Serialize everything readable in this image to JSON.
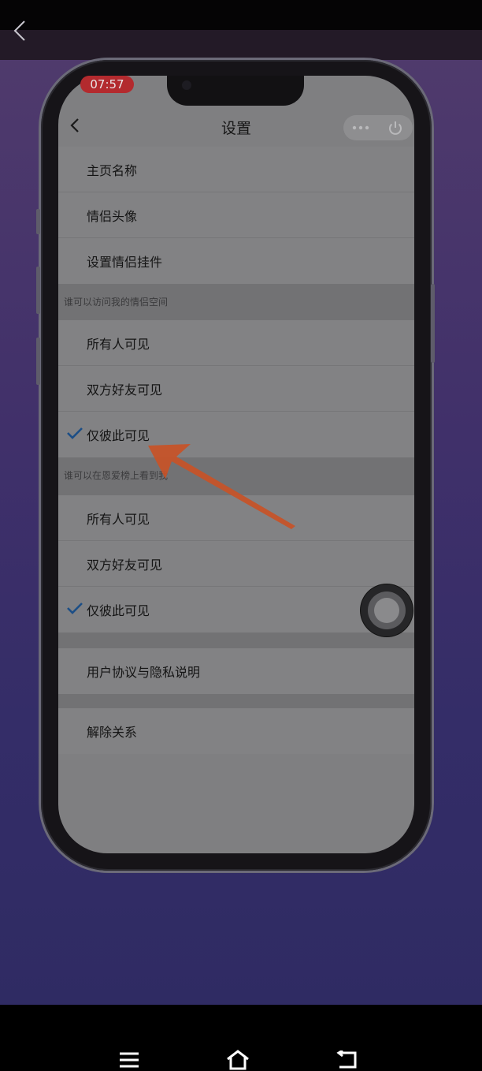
{
  "status": {
    "time": "07:57"
  },
  "header": {
    "title": "设置",
    "more_icon": "more-dots-icon",
    "close_icon": "power-icon"
  },
  "basic": {
    "items": [
      {
        "label": "主页名称"
      },
      {
        "label": "情侣头像"
      },
      {
        "label": "设置情侣挂件"
      }
    ]
  },
  "visit_section": {
    "title": "谁可以访问我的情侣空间",
    "options": [
      {
        "label": "所有人可见",
        "selected": false
      },
      {
        "label": "双方好友可见",
        "selected": false
      },
      {
        "label": "仅彼此可见",
        "selected": true
      }
    ]
  },
  "rank_section": {
    "title": "谁可以在恩爱榜上看到我",
    "options": [
      {
        "label": "所有人可见",
        "selected": false
      },
      {
        "label": "双方好友可见",
        "selected": false
      },
      {
        "label": "仅彼此可见",
        "selected": true
      }
    ]
  },
  "footer_items": [
    {
      "label": "用户协议与隐私说明"
    },
    {
      "label": "解除关系"
    }
  ],
  "colors": {
    "check": "#1c4e86",
    "annotation_arrow": "#c85227",
    "time_pill": "#b32a2e"
  }
}
